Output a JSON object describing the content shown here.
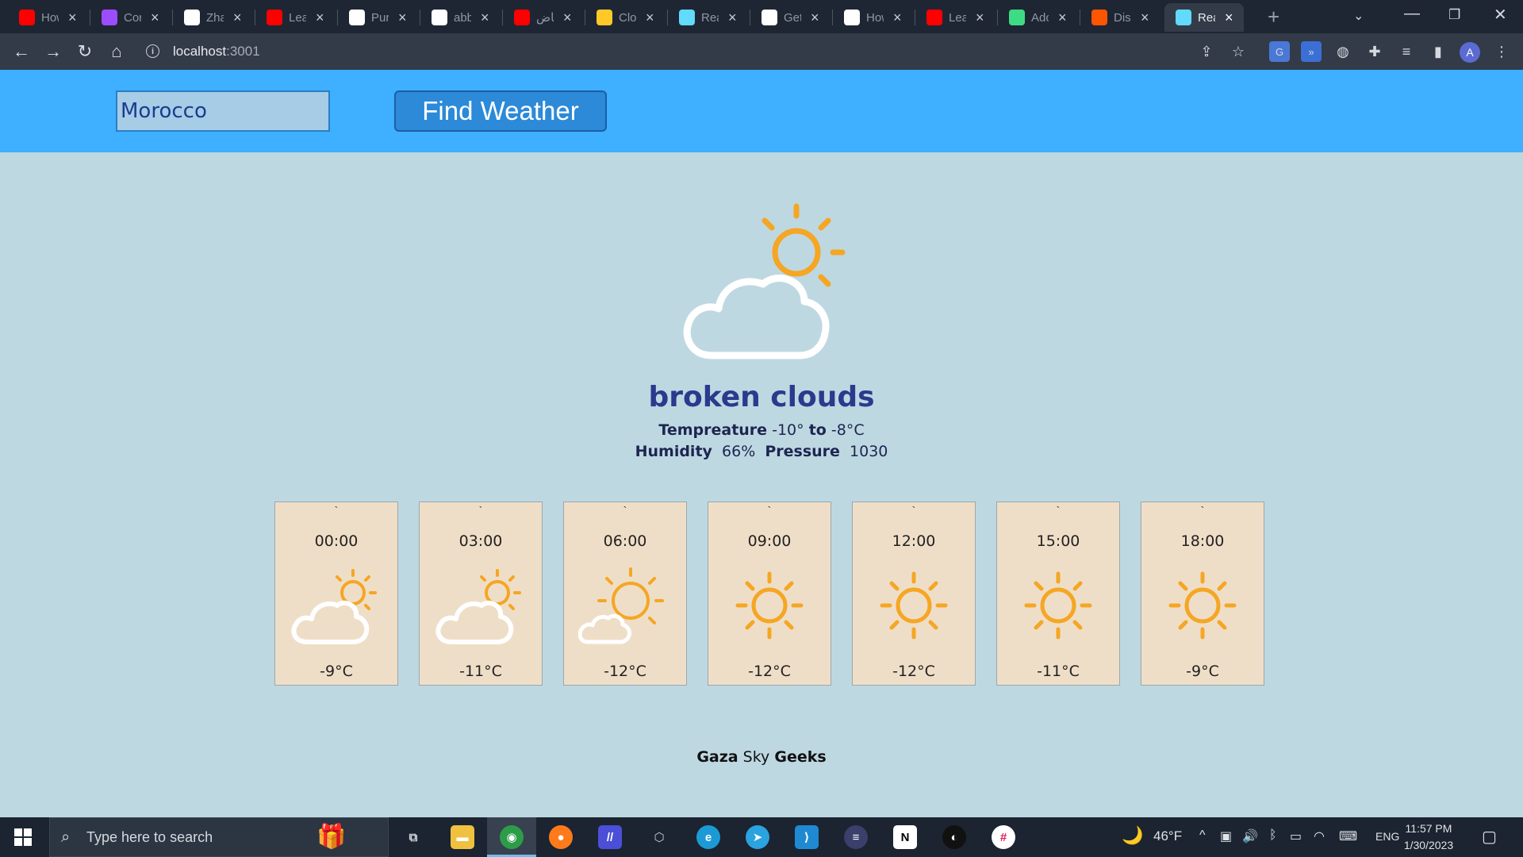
{
  "browser": {
    "tabs": [
      {
        "label": "How",
        "icon": "youtube-icon",
        "color": "#ff0000"
      },
      {
        "label": "Con",
        "icon": "purple-app-icon",
        "color": "#9b4dff"
      },
      {
        "label": "Zha",
        "icon": "github-icon",
        "color": "#ffffff"
      },
      {
        "label": "Lea",
        "icon": "youtube-icon",
        "color": "#ff0000"
      },
      {
        "label": "Pur",
        "icon": "nuxt-icon",
        "color": "#ffffff"
      },
      {
        "label": "abb",
        "icon": "github-icon",
        "color": "#ffffff"
      },
      {
        "label": "رياض",
        "icon": "youtube-icon",
        "color": "#ff0000"
      },
      {
        "label": "Clo",
        "icon": "firebase-icon",
        "color": "#ffca28"
      },
      {
        "label": "Rea",
        "icon": "react-icon",
        "color": "#61dafb"
      },
      {
        "label": "Get",
        "icon": "medium-icon",
        "color": "#ffffff"
      },
      {
        "label": "How",
        "icon": "nuxt-icon",
        "color": "#ffffff"
      },
      {
        "label": "Lea",
        "icon": "youtube-icon",
        "color": "#ff0000"
      },
      {
        "label": "Ado",
        "icon": "react-icon",
        "color": "#3ddc84"
      },
      {
        "label": "Dis",
        "icon": "soundcloud-icon",
        "color": "#ff5500"
      },
      {
        "label": "Rea",
        "icon": "react-icon",
        "color": "#61dafb",
        "active": true
      }
    ],
    "url": "localhost",
    "url_port": ":3001",
    "profile_initial": "A"
  },
  "app": {
    "search": {
      "value": "Morocco",
      "button_label": "Find Weather"
    },
    "current": {
      "condition": "broken clouds",
      "temp_label": "Tempreature",
      "temp_min": "-10°",
      "temp_to": "to",
      "temp_max": "-8°C",
      "humidity_label": "Humidity",
      "humidity_value": "66%",
      "pressure_label": "Pressure",
      "pressure_value": "1030",
      "icon": "partly-cloudy-icon"
    },
    "forecast": [
      {
        "mark": "`",
        "time": "00:00",
        "temp": "-9°C",
        "icon": "cloud-sun-icon"
      },
      {
        "mark": "`",
        "time": "03:00",
        "temp": "-11°C",
        "icon": "cloud-sun-icon"
      },
      {
        "mark": "`",
        "time": "06:00",
        "temp": "-12°C",
        "icon": "sun-small-cloud-icon"
      },
      {
        "mark": "`",
        "time": "09:00",
        "temp": "-12°C",
        "icon": "sun-icon"
      },
      {
        "mark": "`",
        "time": "12:00",
        "temp": "-12°C",
        "icon": "sun-icon"
      },
      {
        "mark": "`",
        "time": "15:00",
        "temp": "-11°C",
        "icon": "sun-icon"
      },
      {
        "mark": "`",
        "time": "18:00",
        "temp": "-9°C",
        "icon": "sun-icon"
      }
    ],
    "footer": {
      "part1": "Gaza",
      "part2": "Sky",
      "part3": "Geeks"
    }
  },
  "taskbar": {
    "search_placeholder": "Type here to search",
    "weather_temp": "46°F",
    "language": "ENG",
    "time": "11:57 PM",
    "date": "1/30/2023"
  },
  "colors": {
    "header_bg": "#3fafff",
    "page_bg": "#bed8e2",
    "card_bg": "#efdec7",
    "sun": "#f5a623",
    "title": "#2b3a8c"
  }
}
